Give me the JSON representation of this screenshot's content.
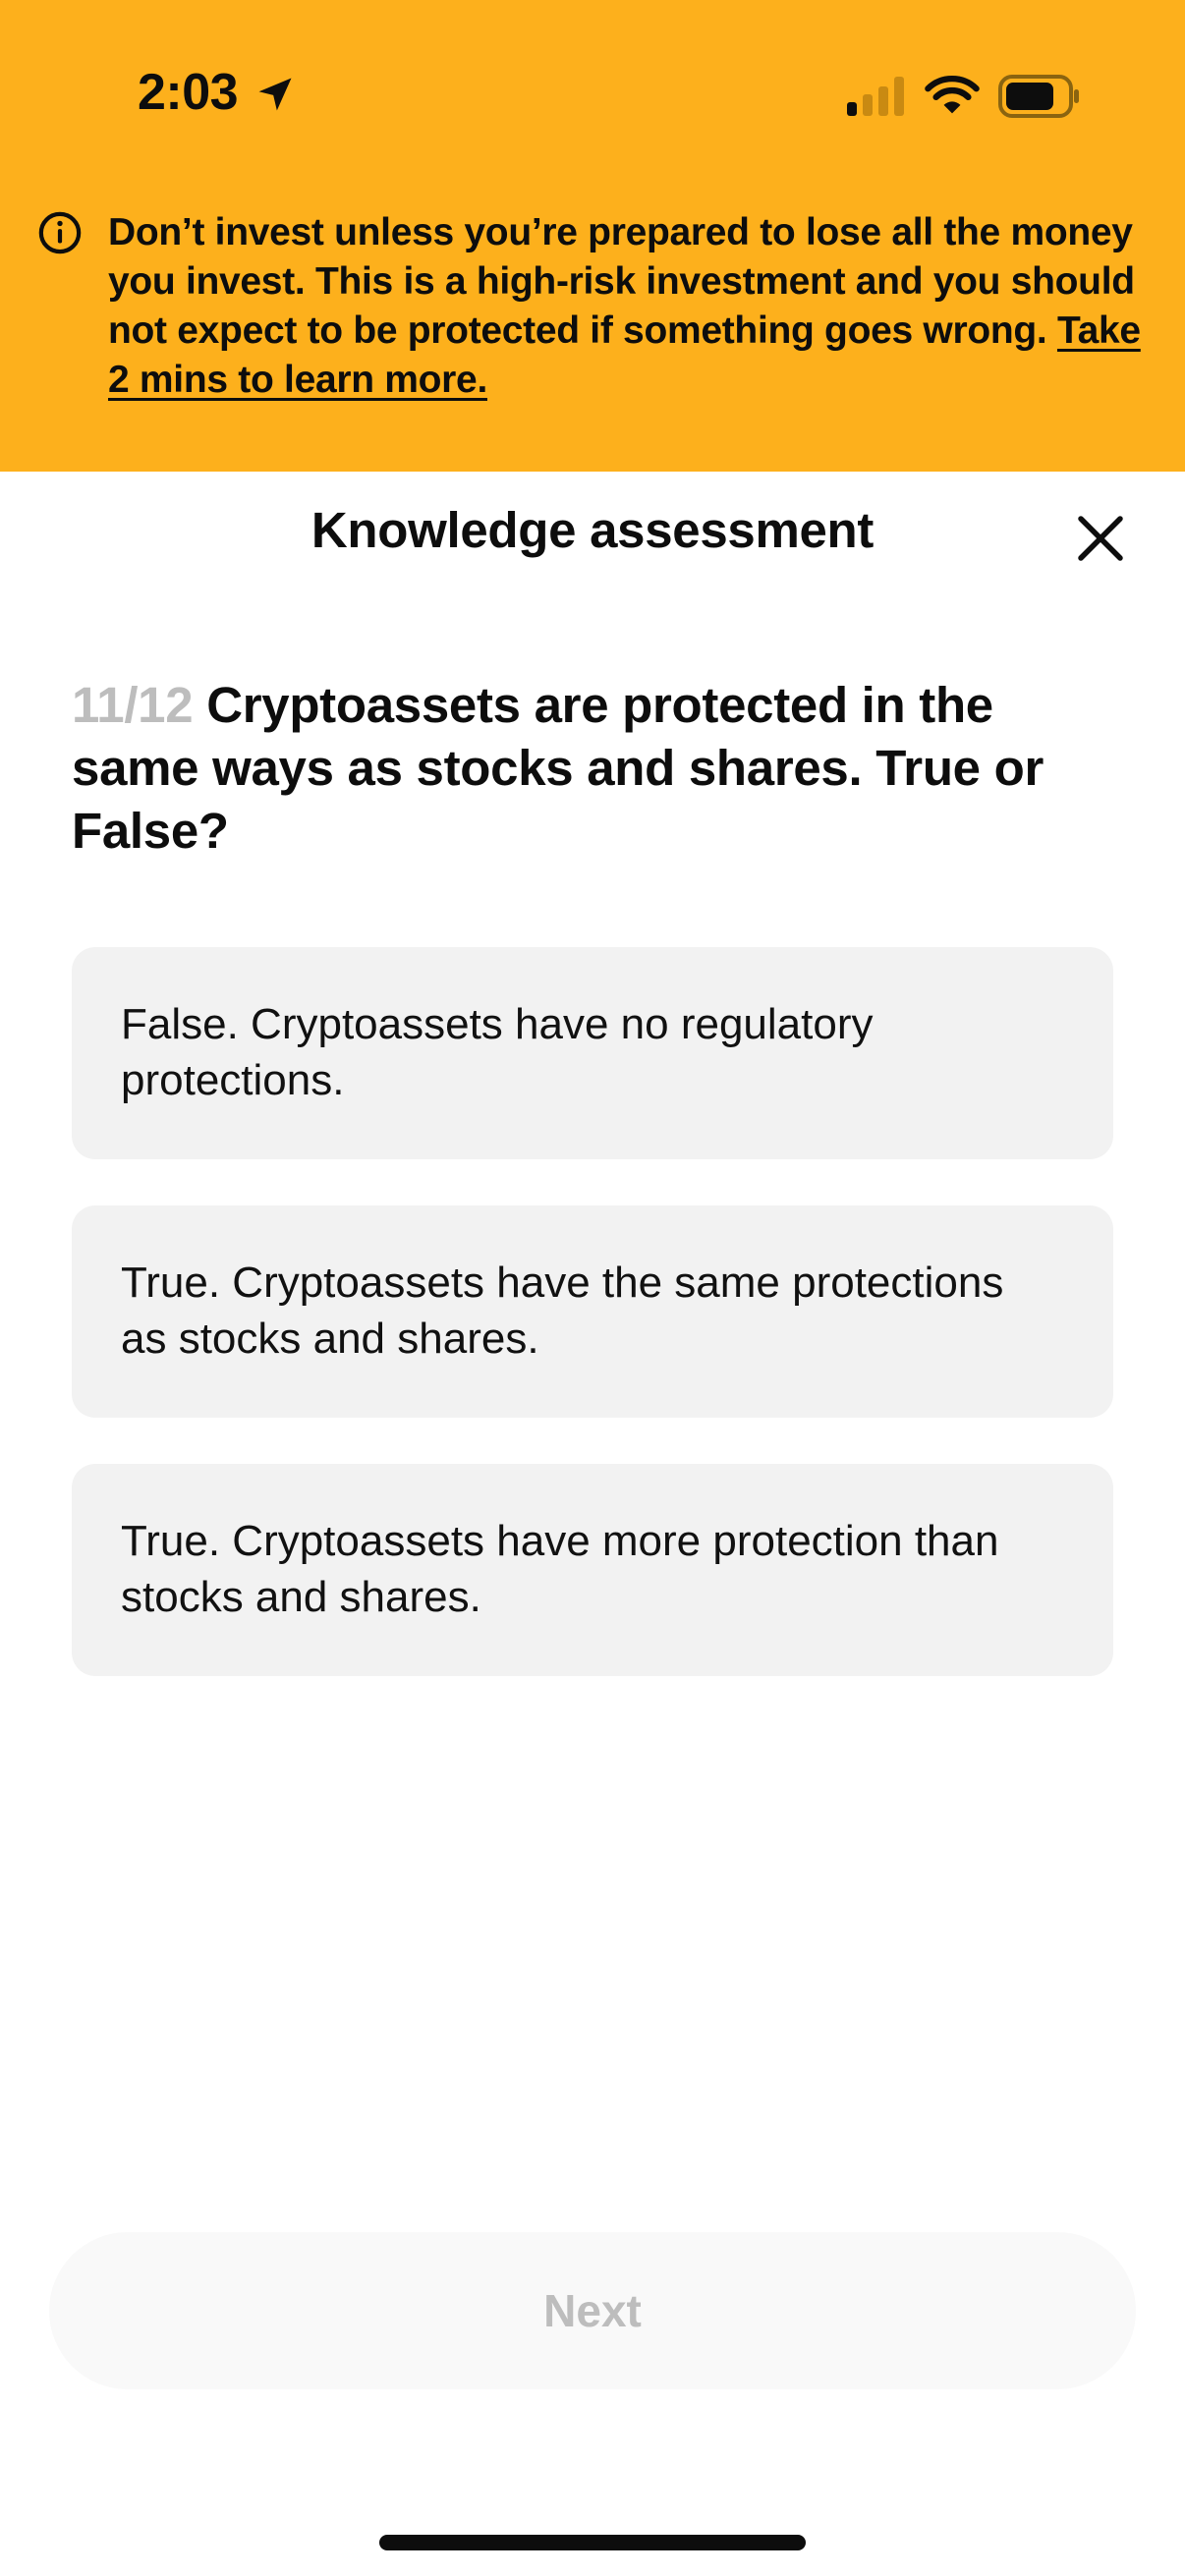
{
  "status_bar": {
    "time": "2:03",
    "icons": [
      "location-arrow-icon",
      "cellular-signal-icon",
      "wifi-icon",
      "battery-icon"
    ]
  },
  "warning_banner": {
    "text": "Don’t invest unless you’re prepared to lose all the money you invest. This is a high-risk investment and you should not expect to be protected if something goes wrong.",
    "link": "Take 2 mins to learn more.",
    "icon": "info-icon",
    "background_color": "#fdb01c"
  },
  "header": {
    "title": "Knowledge assessment",
    "close_icon": "close-icon"
  },
  "question": {
    "counter": "11/12",
    "text": "Cryptoassets are protected in the same ways as stocks and shares. True or False?"
  },
  "options": [
    {
      "label": "False. Cryptoassets have no regulatory protections."
    },
    {
      "label": "True. Cryptoassets have the same protections as stocks and shares."
    },
    {
      "label": "True. Cryptoassets have more protection than stocks and shares."
    }
  ],
  "footer": {
    "next_label": "Next"
  }
}
